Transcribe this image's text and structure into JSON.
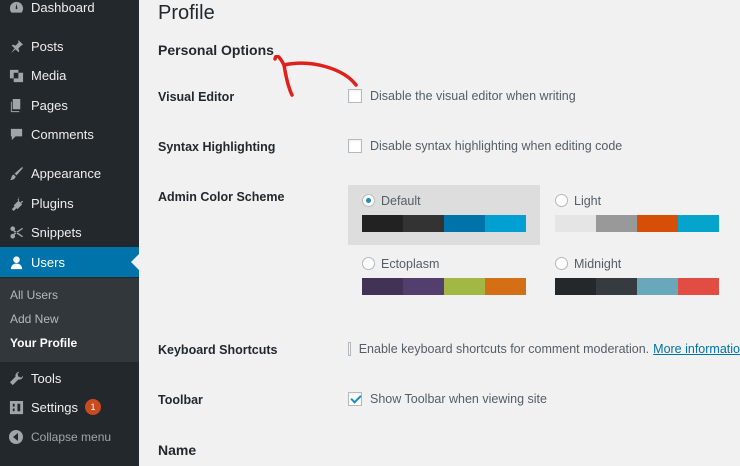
{
  "sidebar": {
    "items": [
      {
        "label": "Dashboard",
        "icon": "dashboard-icon"
      },
      {
        "label": "Posts",
        "icon": "pin-icon"
      },
      {
        "label": "Media",
        "icon": "media-icon"
      },
      {
        "label": "Pages",
        "icon": "pages-icon"
      },
      {
        "label": "Comments",
        "icon": "comments-icon"
      },
      {
        "label": "Appearance",
        "icon": "brush-icon"
      },
      {
        "label": "Plugins",
        "icon": "plugin-icon"
      },
      {
        "label": "Snippets",
        "icon": "scissors-icon"
      },
      {
        "label": "Users",
        "icon": "user-icon"
      },
      {
        "label": "Tools",
        "icon": "wrench-icon"
      },
      {
        "label": "Settings",
        "icon": "settings-icon",
        "badge": "1"
      }
    ],
    "submenu": [
      "All Users",
      "Add New",
      "Your Profile"
    ],
    "collapse_label": "Collapse menu"
  },
  "page": {
    "title": "Profile",
    "section_personal": "Personal Options",
    "section_name": "Name"
  },
  "options": {
    "visual_editor": {
      "label": "Visual Editor",
      "option": "Disable the visual editor when writing",
      "checked": false
    },
    "syntax": {
      "label": "Syntax Highlighting",
      "option": "Disable syntax highlighting when editing code",
      "checked": false
    },
    "color_scheme": {
      "label": "Admin Color Scheme",
      "schemes": [
        {
          "name": "Default",
          "selected": true,
          "colors": [
            "#222222",
            "#333333",
            "#0073aa",
            "#00a0d2"
          ]
        },
        {
          "name": "Light",
          "selected": false,
          "colors": [
            "#e5e5e5",
            "#999999",
            "#d64e07",
            "#04a4cc"
          ]
        },
        {
          "name": "Ectoplasm",
          "selected": false,
          "colors": [
            "#413256",
            "#523f6d",
            "#a3b745",
            "#d46f15"
          ]
        },
        {
          "name": "Midnight",
          "selected": false,
          "colors": [
            "#25282b",
            "#363b3f",
            "#69a8bb",
            "#e14d43"
          ]
        }
      ]
    },
    "keyboard": {
      "label": "Keyboard Shortcuts",
      "option": "Enable keyboard shortcuts for comment moderation.",
      "link": "More informatio",
      "checked": false
    },
    "toolbar": {
      "label": "Toolbar",
      "option": "Show Toolbar when viewing site",
      "checked": true
    }
  },
  "colors": {
    "sidebar_bg": "#23282d",
    "accent": "#0073aa",
    "annotation": "#e0201b"
  }
}
